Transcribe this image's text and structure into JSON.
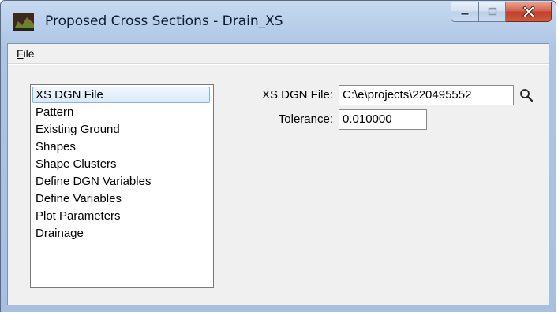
{
  "window": {
    "title": "Proposed Cross Sections - Drain_XS",
    "icon": "proposed-cross-sections-app-icon",
    "buttons": {
      "minimize": "minimize-icon",
      "maximize": "maximize-icon",
      "close": "close-icon"
    },
    "colors": {
      "close_button": "#c7432c",
      "titlebar": "#b9cfea",
      "selection_border": "#7eb4ea"
    }
  },
  "menu": {
    "file": {
      "mnemonic": "F",
      "rest": "ile"
    }
  },
  "categories": {
    "items": [
      "XS DGN File",
      "Pattern",
      "Existing Ground",
      "Shapes",
      "Shape Clusters",
      "Define DGN Variables",
      "Define Variables",
      "Plot Parameters",
      "Drainage"
    ],
    "selected": "XS DGN File"
  },
  "form": {
    "xs_dgn_file": {
      "label": "XS DGN File:",
      "value": "C:\\e\\projects\\220495552"
    },
    "tolerance": {
      "label": "Tolerance:",
      "value": "0.010000"
    },
    "browse_icon": "search-icon"
  }
}
